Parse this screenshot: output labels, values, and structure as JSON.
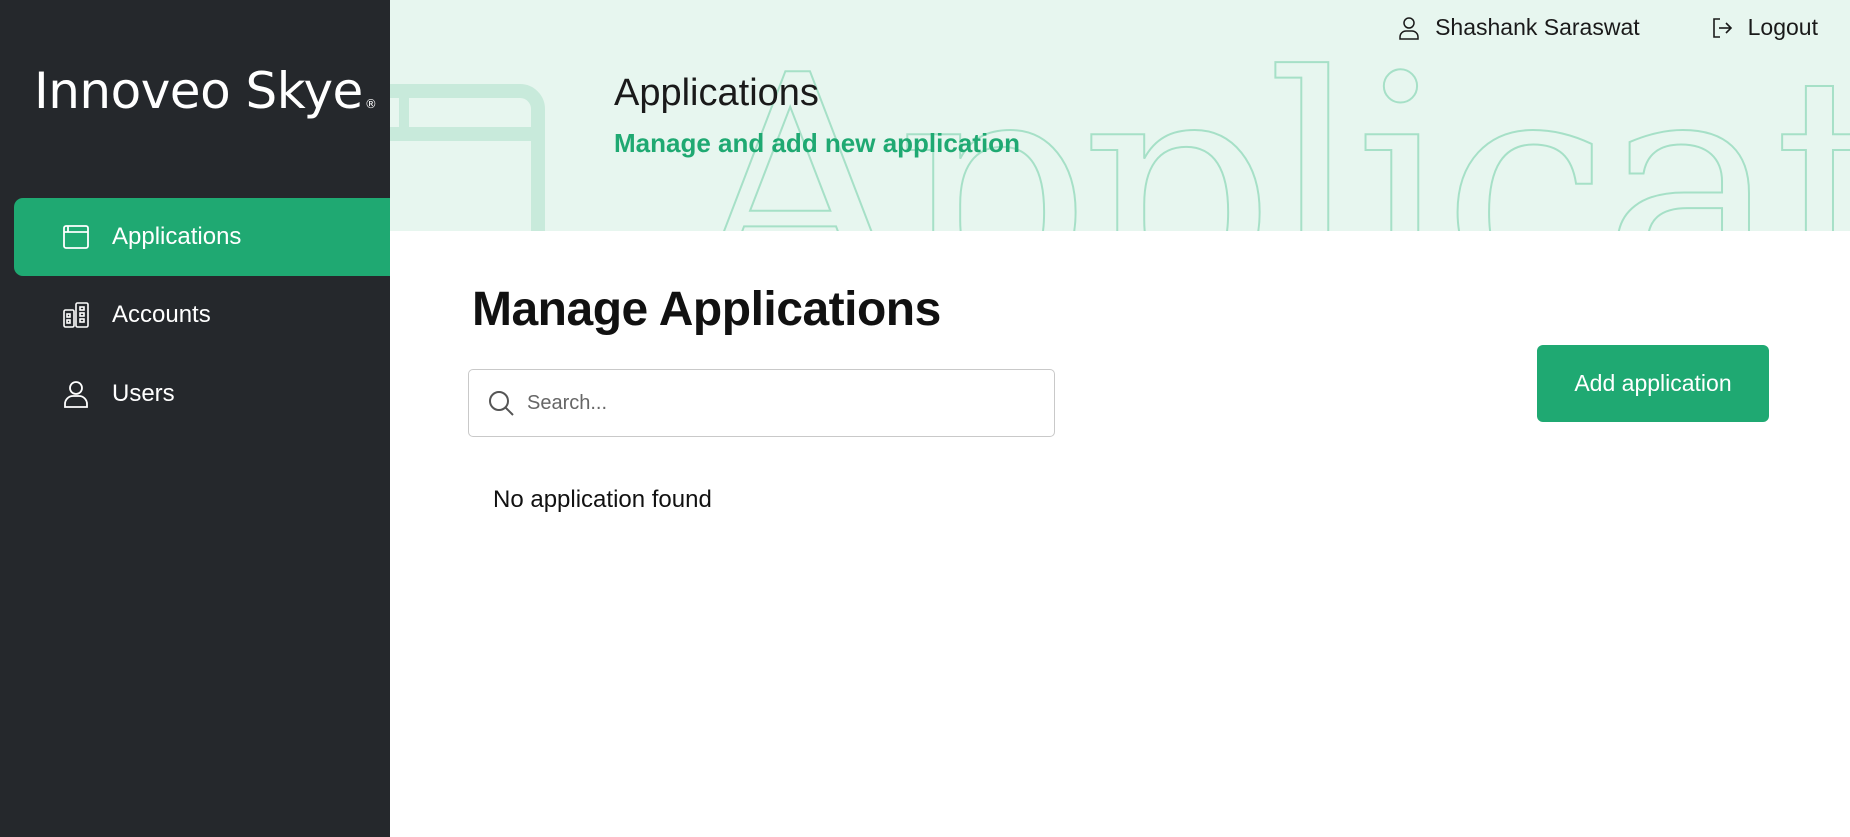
{
  "brand": {
    "name": "Innoveo Skye",
    "mark": "®"
  },
  "sidebar": {
    "items": [
      {
        "label": "Applications",
        "icon": "window-icon",
        "active": true
      },
      {
        "label": "Accounts",
        "icon": "buildings-icon",
        "active": false
      },
      {
        "label": "Users",
        "icon": "user-icon",
        "active": false
      }
    ]
  },
  "header": {
    "title": "Applications",
    "subtitle": "Manage and add new application",
    "watermark": "Applicati",
    "user_name": "Shashank Saraswat",
    "logout_label": "Logout"
  },
  "main": {
    "heading": "Manage Applications",
    "search_placeholder": "Search...",
    "search_value": "",
    "add_button_label": "Add application",
    "empty_message": "No application found"
  },
  "colors": {
    "sidebar_bg": "#25282c",
    "accent": "#1fa972",
    "header_bg": "#e7f6ef",
    "watermark_stroke": "#a6e0c7"
  }
}
